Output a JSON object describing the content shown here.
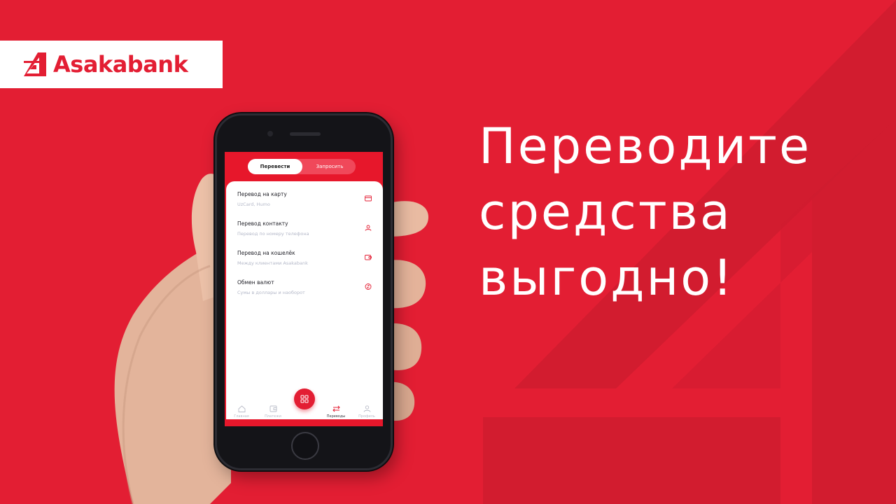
{
  "brand": {
    "name": "Asakabank",
    "color": "#e31e33"
  },
  "headline": {
    "line1": "Переводите",
    "line2": "средства",
    "line3": "выгодно!"
  },
  "app": {
    "segments": {
      "active": "Перевести",
      "inactive": "Запросить"
    },
    "options": [
      {
        "title": "Перевод на карту",
        "subtitle": "UzCard, Humo",
        "icon": "card-icon"
      },
      {
        "title": "Перевод контакту",
        "subtitle": "Перевод по номеру телефона",
        "icon": "contact-icon"
      },
      {
        "title": "Перевод на кошелёк",
        "subtitle": "Между клиентами Asakabank",
        "icon": "wallet-icon"
      },
      {
        "title": "Обмен валют",
        "subtitle": "Сумы в доллары и наоборот",
        "icon": "exchange-icon"
      }
    ],
    "tabbar": {
      "home": "Главная",
      "payments": "Платежи",
      "transfers": "Переводы",
      "profile": "Профиль",
      "active": "transfers"
    }
  }
}
